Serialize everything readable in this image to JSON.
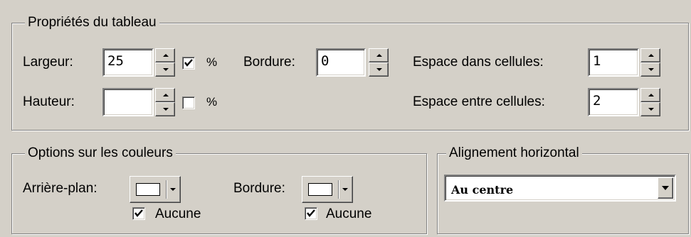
{
  "table_properties": {
    "legend": "Propriétés du tableau",
    "largeur": {
      "label": "Largeur:",
      "value": "25",
      "percent_checked": true,
      "percent_label": "%"
    },
    "hauteur": {
      "label": "Hauteur:",
      "value": "",
      "percent_checked": false,
      "percent_label": "%"
    },
    "bordure": {
      "label": "Bordure:",
      "value": "0"
    },
    "espace_dans": {
      "label": "Espace dans cellules:",
      "value": "1"
    },
    "espace_entre": {
      "label": "Espace entre cellules:",
      "value": "2"
    }
  },
  "color_options": {
    "legend": "Options sur les couleurs",
    "background": {
      "label": "Arrière-plan:",
      "swatch_color": "#ffffff",
      "none_checked": true,
      "none_label": "Aucune"
    },
    "border": {
      "label": "Bordure:",
      "swatch_color": "#ffffff",
      "none_checked": true,
      "none_label": "Aucune"
    }
  },
  "alignment": {
    "legend": "Alignement horizontal",
    "selected": "Au centre"
  },
  "icons": {
    "spin_up": "up-arrow-icon",
    "spin_down": "down-arrow-icon",
    "dropdown": "chevron-down-icon",
    "check": "checkmark-icon"
  }
}
